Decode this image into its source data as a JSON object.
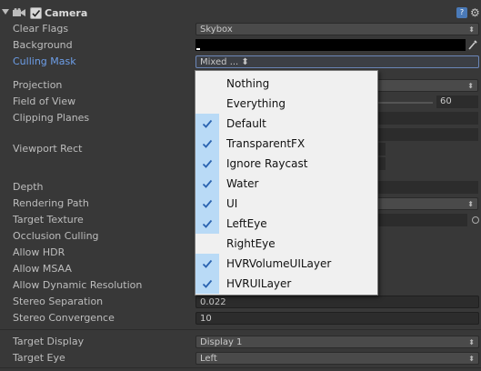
{
  "component": {
    "title": "Camera"
  },
  "labels": {
    "clear_flags": "Clear Flags",
    "background": "Background",
    "culling_mask": "Culling Mask",
    "projection": "Projection",
    "field_of_view": "Field of View",
    "clipping_planes": "Clipping Planes",
    "viewport_rect": "Viewport Rect",
    "depth": "Depth",
    "rendering_path": "Rendering Path",
    "target_texture": "Target Texture",
    "occlusion_culling": "Occlusion Culling",
    "allow_hdr": "Allow HDR",
    "allow_msaa": "Allow MSAA",
    "allow_dynamic_resolution": "Allow Dynamic Resolution",
    "stereo_separation": "Stereo Separation",
    "stereo_convergence": "Stereo Convergence",
    "target_display": "Target Display",
    "target_eye": "Target Eye"
  },
  "values": {
    "clear_flags": "Skybox",
    "culling_mask": "Mixed ...",
    "field_of_view": "60",
    "stereo_separation": "0.022",
    "stereo_convergence": "10",
    "target_display": "Display 1",
    "target_eye": "Left"
  },
  "colors": {
    "background_swatch": "#000000",
    "menu_check_gutter": "#b9daf6",
    "culling_highlight": "#6d9ee8"
  },
  "culling_menu": [
    {
      "label": "Nothing",
      "checked": false
    },
    {
      "label": "Everything",
      "checked": false
    },
    {
      "label": "Default",
      "checked": true
    },
    {
      "label": "TransparentFX",
      "checked": true
    },
    {
      "label": "Ignore Raycast",
      "checked": true
    },
    {
      "label": "Water",
      "checked": true
    },
    {
      "label": "UI",
      "checked": true
    },
    {
      "label": "LeftEye",
      "checked": true
    },
    {
      "label": "RightEye",
      "checked": false
    },
    {
      "label": "HVRVolumeUILayer",
      "checked": true
    },
    {
      "label": "HVRUILayer",
      "checked": true
    }
  ],
  "icons": [
    "foldout-arrow-icon",
    "camera-icon",
    "enable-checkbox-icon",
    "help-icon",
    "gear-icon",
    "eyedropper-icon",
    "checkmark-icon",
    "object-picker-icon"
  ]
}
